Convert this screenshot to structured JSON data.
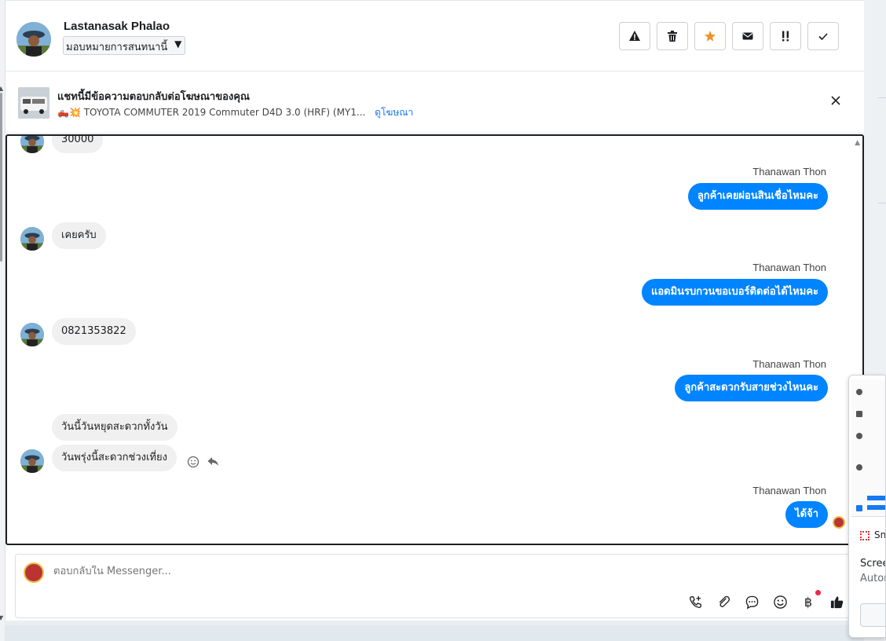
{
  "header": {
    "contact_name": "Lastanasak Phalao",
    "assign_label": "มอบหมายการสนทนานี้",
    "actions": [
      {
        "name": "report-spam-button",
        "icon": "warning-icon"
      },
      {
        "name": "delete-button",
        "icon": "trash-icon"
      },
      {
        "name": "star-button",
        "icon": "star-icon"
      },
      {
        "name": "mark-unread-button",
        "icon": "envelope-icon"
      },
      {
        "name": "follow-up-button",
        "icon": "exclamation-icon"
      },
      {
        "name": "mark-done-button",
        "icon": "check-icon"
      }
    ]
  },
  "ad_banner": {
    "title": "แชทนี้มีข้อความตอบกลับต่อโฆษณาของคุณ",
    "subtitle": "🛻💥 TOYOTA COMMUTER 2019 Commuter D4D 3.0 (HRF) (MY1...",
    "link": "ดูโฆษณา"
  },
  "messages": {
    "in_1": "30000",
    "sender_1": "Thanawan Thon",
    "out_1": "ลูกค้าเคยผ่อนสินเชื่อไหมคะ",
    "in_2": "เคยครับ",
    "sender_2": "Thanawan Thon",
    "out_2": "แอดมินรบกวนขอเบอร์ติดต่อได้ไหมคะ",
    "in_3": "0821353822",
    "sender_3": "Thanawan Thon",
    "out_3": "ลูกค้าสะดวกรับสายช่วงไหนคะ",
    "in_4": "วันนี้วันหยุดสะดวกทั้งวัน",
    "in_5": "วันพรุ่งนี้สะดวกช่วงเที่ยง",
    "sender_4": "Thanawan Thon",
    "out_4": "ได้จ้า"
  },
  "composer": {
    "placeholder": "ตอบกลับใน Messenger...",
    "currency_symbol": "฿"
  },
  "side_widget": {
    "snip_label": "Sn",
    "line1": "Scree",
    "line2": "Autor"
  },
  "colors": {
    "outgoing_bubble": "#0084ff",
    "incoming_bubble": "#f0f0f0",
    "link": "#1877f2",
    "notification_dot": "#f02849"
  }
}
